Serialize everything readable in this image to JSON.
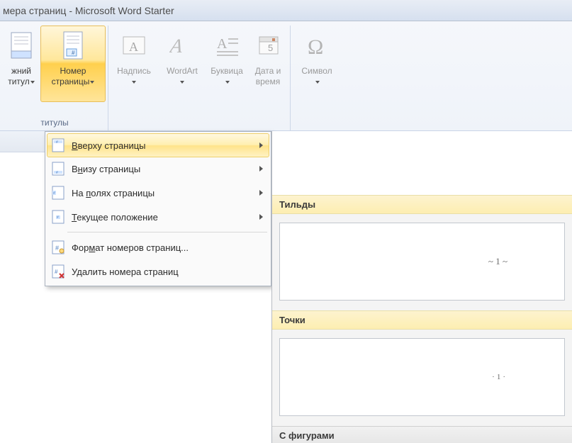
{
  "title_bar": "мера страниц  -  Microsoft Word Starter",
  "ribbon": {
    "footer_btn": {
      "line1": "жний",
      "line2": "титул"
    },
    "page_number": {
      "line1": "Номер",
      "line2": "страницы"
    },
    "text_box": "Надпись",
    "wordart": "WordArt",
    "dropcap": "Буквица",
    "datetime": {
      "line1": "Дата и",
      "line2": "время"
    },
    "symbol": "Символ",
    "group_label": "титулы"
  },
  "dropdown": {
    "top": "Вверху страницы",
    "bottom": "Внизу страницы",
    "margins": "На полях страницы",
    "current": "Текущее положение",
    "format": "Формат номеров страниц...",
    "remove": "Удалить номера страниц"
  },
  "gallery": {
    "tildes": "Тильды",
    "tilde_preview": "~ 1 ~",
    "dots": "Точки",
    "dots_preview": "·1·",
    "shapes": "С фигурами"
  },
  "mnemonics": {
    "top": "В",
    "bottom": "н",
    "margins": "п",
    "current": "Т",
    "format": "м"
  }
}
